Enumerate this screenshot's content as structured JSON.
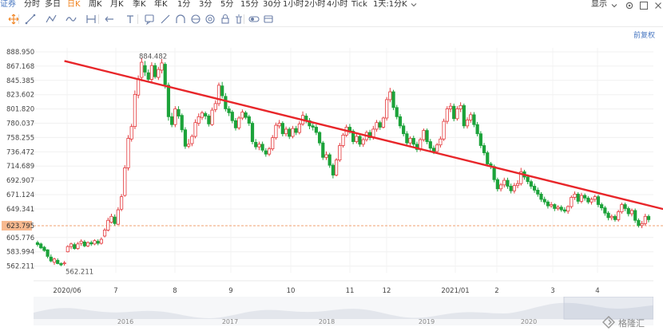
{
  "top_toolbar": {
    "cut_label": "证券",
    "periods": [
      "分时",
      "多日",
      "日K",
      "周K",
      "月K",
      "季K",
      "年K",
      "1分",
      "3分",
      "5分",
      "15分",
      "30分",
      "1小时",
      "2小时",
      "4小时",
      "Tick",
      "1天:1分K"
    ],
    "active_period": "日K",
    "display_label": "显示"
  },
  "draw_toolbar": {
    "tools": [
      "move-tool-icon",
      "line-tool-icon",
      "polyline-tool-icon",
      "wave-tool-icon",
      "range-tool-icon",
      "arrow-tool-icon",
      "text-tool-icon",
      "comment-tool-icon",
      "ruler-tool-icon",
      "arc-tool-icon",
      "fibonacci-tool-icon",
      "cycle-tool-icon",
      "lock-tool-icon",
      "delete-tool-icon",
      "toggle-tool-icon",
      "layers-tool-icon"
    ]
  },
  "adjust_label": "前复权",
  "colors": {
    "up": "#e4393c",
    "down": "#1ca33a",
    "trend_arrow": "#e8262a",
    "current_line": "#f2a070",
    "current_bg": "#f7b98f"
  },
  "price_axis": {
    "ticks": [
      "888.950",
      "867.168",
      "845.385",
      "823.602",
      "801.820",
      "780.037",
      "758.255",
      "736.472",
      "714.689",
      "692.907",
      "671.124",
      "649.341",
      "623.795",
      "605.776",
      "583.994",
      "562.211"
    ],
    "current": "623.795"
  },
  "date_axis": {
    "labels": [
      "2020/06",
      "7",
      "8",
      "9",
      "10",
      "11",
      "12",
      "2021/01",
      "2",
      "3",
      "4"
    ]
  },
  "annotations": {
    "high_label": "884.482",
    "low_label": "562.211"
  },
  "navigator": {
    "years": [
      "2016",
      "2017",
      "2018",
      "2019",
      "2020"
    ]
  },
  "watermark": "格隆汇",
  "chart_data": {
    "type": "candlestick",
    "title": "",
    "ylim": [
      552,
      895
    ],
    "current_price": 623.795,
    "max_marked": 884.482,
    "min_marked": 562.211,
    "trend_arrow": {
      "from": [
        8,
        875
      ],
      "to": [
        207,
        623
      ]
    },
    "candles": [
      [
        598,
        595,
        601,
        592
      ],
      [
        596,
        590,
        598,
        588
      ],
      [
        591,
        586,
        593,
        584
      ],
      [
        587,
        577,
        588,
        574
      ],
      [
        576,
        570,
        580,
        568
      ],
      [
        568,
        573,
        575,
        564
      ],
      [
        571,
        566,
        574,
        565
      ],
      [
        566,
        564,
        568,
        562
      ],
      [
        566,
        567,
        570,
        563
      ],
      [
        584,
        592,
        594,
        583
      ],
      [
        592,
        596,
        598,
        588
      ],
      [
        595,
        589,
        598,
        587
      ],
      [
        589,
        596,
        599,
        587
      ],
      [
        597,
        600,
        603,
        593
      ],
      [
        599,
        593,
        602,
        591
      ],
      [
        593,
        598,
        600,
        591
      ],
      [
        598,
        596,
        601,
        593
      ],
      [
        596,
        601,
        603,
        594
      ],
      [
        600,
        597,
        603,
        594
      ],
      [
        597,
        603,
        606,
        595
      ],
      [
        608,
        617,
        620,
        606
      ],
      [
        617,
        632,
        636,
        615
      ],
      [
        629,
        638,
        642,
        627
      ],
      [
        637,
        627,
        641,
        624
      ],
      [
        626,
        648,
        652,
        625
      ],
      [
        649,
        668,
        672,
        646
      ],
      [
        670,
        712,
        716,
        668
      ],
      [
        712,
        757,
        762,
        708
      ],
      [
        756,
        775,
        779,
        752
      ],
      [
        775,
        824,
        830,
        771
      ],
      [
        823,
        848,
        853,
        818
      ],
      [
        850,
        873,
        880,
        844
      ],
      [
        868,
        858,
        875,
        852
      ],
      [
        857,
        847,
        862,
        843
      ],
      [
        847,
        868,
        873,
        843
      ],
      [
        868,
        851,
        872,
        848
      ],
      [
        850,
        862,
        866,
        846
      ],
      [
        861,
        872,
        878,
        856
      ],
      [
        870,
        839,
        873,
        833
      ],
      [
        838,
        790,
        842,
        784
      ],
      [
        790,
        778,
        796,
        774
      ],
      [
        778,
        802,
        806,
        774
      ],
      [
        801,
        791,
        806,
        787
      ],
      [
        792,
        770,
        795,
        766
      ],
      [
        770,
        745,
        774,
        741
      ],
      [
        745,
        748,
        756,
        742
      ],
      [
        749,
        760,
        763,
        745
      ],
      [
        760,
        781,
        786,
        757
      ],
      [
        780,
        790,
        795,
        776
      ],
      [
        789,
        796,
        799,
        785
      ],
      [
        795,
        791,
        798,
        786
      ],
      [
        791,
        779,
        794,
        775
      ],
      [
        778,
        800,
        804,
        776
      ],
      [
        801,
        810,
        815,
        797
      ],
      [
        810,
        838,
        842,
        806
      ],
      [
        837,
        822,
        843,
        818
      ],
      [
        821,
        802,
        826,
        798
      ],
      [
        802,
        796,
        806,
        791
      ],
      [
        797,
        784,
        800,
        780
      ],
      [
        784,
        773,
        788,
        769
      ],
      [
        773,
        788,
        791,
        770
      ],
      [
        788,
        797,
        801,
        785
      ],
      [
        796,
        789,
        799,
        786
      ],
      [
        790,
        780,
        793,
        776
      ],
      [
        780,
        752,
        783,
        748
      ],
      [
        751,
        744,
        756,
        740
      ],
      [
        744,
        748,
        752,
        739
      ],
      [
        748,
        739,
        752,
        736
      ],
      [
        738,
        733,
        742,
        729
      ],
      [
        733,
        741,
        744,
        730
      ],
      [
        741,
        758,
        762,
        738
      ],
      [
        758,
        777,
        781,
        755
      ],
      [
        776,
        780,
        785,
        772
      ],
      [
        780,
        764,
        783,
        760
      ],
      [
        764,
        771,
        775,
        760
      ],
      [
        771,
        760,
        774,
        756
      ],
      [
        760,
        772,
        776,
        757
      ],
      [
        772,
        766,
        776,
        762
      ],
      [
        766,
        779,
        783,
        763
      ],
      [
        779,
        792,
        798,
        776
      ],
      [
        791,
        784,
        795,
        780
      ],
      [
        784,
        776,
        788,
        771
      ],
      [
        776,
        774,
        780,
        769
      ],
      [
        774,
        766,
        778,
        762
      ],
      [
        766,
        750,
        768,
        746
      ],
      [
        750,
        728,
        753,
        724
      ],
      [
        728,
        732,
        737,
        724
      ],
      [
        732,
        716,
        735,
        712
      ],
      [
        716,
        701,
        719,
        696
      ],
      [
        701,
        724,
        727,
        699
      ],
      [
        724,
        746,
        750,
        721
      ],
      [
        746,
        762,
        765,
        743
      ],
      [
        762,
        774,
        778,
        759
      ],
      [
        774,
        768,
        779,
        764
      ],
      [
        768,
        752,
        771,
        748
      ],
      [
        752,
        760,
        764,
        749
      ],
      [
        760,
        748,
        763,
        744
      ],
      [
        748,
        755,
        758,
        744
      ],
      [
        755,
        766,
        769,
        752
      ],
      [
        766,
        758,
        770,
        754
      ],
      [
        758,
        771,
        776,
        755
      ],
      [
        771,
        781,
        785,
        767
      ],
      [
        781,
        774,
        784,
        770
      ],
      [
        774,
        788,
        790,
        772
      ],
      [
        788,
        816,
        820,
        784
      ],
      [
        816,
        828,
        834,
        812
      ],
      [
        828,
        804,
        831,
        800
      ],
      [
        804,
        790,
        808,
        786
      ],
      [
        790,
        776,
        794,
        772
      ],
      [
        776,
        764,
        780,
        760
      ],
      [
        764,
        750,
        768,
        746
      ],
      [
        750,
        757,
        760,
        746
      ],
      [
        757,
        748,
        761,
        744
      ],
      [
        748,
        740,
        752,
        736
      ],
      [
        740,
        755,
        758,
        737
      ],
      [
        755,
        769,
        772,
        752
      ],
      [
        769,
        752,
        772,
        748
      ],
      [
        752,
        742,
        756,
        738
      ],
      [
        742,
        737,
        746,
        733
      ],
      [
        737,
        747,
        750,
        734
      ],
      [
        747,
        756,
        760,
        743
      ],
      [
        756,
        783,
        787,
        753
      ],
      [
        783,
        802,
        806,
        779
      ],
      [
        802,
        806,
        811,
        797
      ],
      [
        806,
        787,
        810,
        783
      ],
      [
        787,
        802,
        806,
        784
      ],
      [
        802,
        807,
        812,
        797
      ],
      [
        807,
        776,
        810,
        772
      ],
      [
        776,
        785,
        789,
        772
      ],
      [
        785,
        793,
        797,
        781
      ],
      [
        793,
        778,
        797,
        774
      ],
      [
        778,
        764,
        782,
        760
      ],
      [
        764,
        746,
        768,
        742
      ],
      [
        746,
        735,
        750,
        731
      ],
      [
        735,
        718,
        738,
        714
      ],
      [
        718,
        714,
        721,
        710
      ],
      [
        714,
        694,
        717,
        690
      ],
      [
        694,
        680,
        697,
        676
      ],
      [
        680,
        686,
        689,
        676
      ],
      [
        686,
        693,
        697,
        682
      ],
      [
        693,
        684,
        697,
        680
      ],
      [
        684,
        677,
        688,
        673
      ],
      [
        677,
        685,
        689,
        673
      ],
      [
        685,
        688,
        693,
        681
      ],
      [
        688,
        706,
        712,
        685
      ],
      [
        706,
        698,
        709,
        694
      ],
      [
        698,
        691,
        702,
        687
      ],
      [
        691,
        684,
        694,
        680
      ],
      [
        684,
        678,
        688,
        674
      ],
      [
        678,
        672,
        682,
        668
      ],
      [
        672,
        664,
        675,
        660
      ],
      [
        664,
        660,
        668,
        656
      ],
      [
        660,
        654,
        663,
        650
      ],
      [
        654,
        656,
        660,
        651
      ],
      [
        656,
        650,
        658,
        646
      ],
      [
        650,
        652,
        655,
        647
      ],
      [
        652,
        648,
        655,
        645
      ],
      [
        648,
        646,
        652,
        643
      ],
      [
        646,
        653,
        655,
        642
      ],
      [
        653,
        667,
        670,
        650
      ],
      [
        667,
        672,
        676,
        663
      ],
      [
        672,
        661,
        675,
        657
      ],
      [
        661,
        670,
        674,
        658
      ],
      [
        670,
        666,
        673,
        662
      ],
      [
        666,
        660,
        669,
        657
      ],
      [
        660,
        664,
        667,
        656
      ],
      [
        664,
        668,
        671,
        660
      ],
      [
        668,
        656,
        671,
        652
      ],
      [
        656,
        651,
        659,
        647
      ],
      [
        651,
        643,
        654,
        639
      ],
      [
        643,
        636,
        646,
        632
      ],
      [
        636,
        638,
        641,
        632
      ],
      [
        638,
        633,
        641,
        630
      ],
      [
        633,
        645,
        648,
        630
      ],
      [
        645,
        656,
        659,
        642
      ],
      [
        656,
        650,
        659,
        646
      ],
      [
        650,
        642,
        653,
        638
      ],
      [
        642,
        647,
        650,
        638
      ],
      [
        647,
        632,
        650,
        628
      ],
      [
        632,
        624,
        635,
        621
      ],
      [
        624,
        627,
        631,
        620
      ],
      [
        627,
        638,
        642,
        624
      ],
      [
        638,
        633,
        641,
        629
      ]
    ]
  }
}
